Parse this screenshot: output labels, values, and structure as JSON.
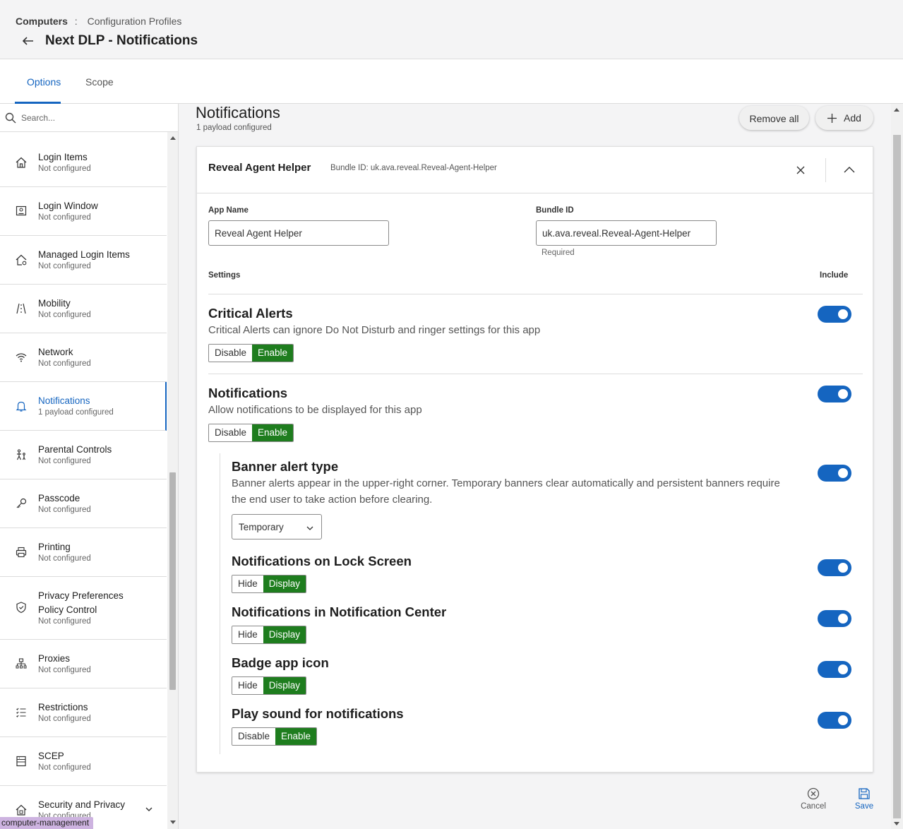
{
  "header": {
    "breadcrumb_root": "Computers",
    "breadcrumb_sep": ":",
    "breadcrumb_child": "Configuration Profiles",
    "title": "Next DLP - Notifications"
  },
  "tabs": [
    {
      "label": "Options",
      "active": true
    },
    {
      "label": "Scope",
      "active": false
    }
  ],
  "sidebar": {
    "search_placeholder": "Search...",
    "items": [
      {
        "label": "Login Items",
        "status": "Not configured",
        "icon": "home-icon"
      },
      {
        "label": "Login Window",
        "status": "Not configured",
        "icon": "login-window-icon"
      },
      {
        "label": "Managed Login Items",
        "status": "Not configured",
        "icon": "managed-home-icon"
      },
      {
        "label": "Mobility",
        "status": "Not configured",
        "icon": "mobility-icon"
      },
      {
        "label": "Network",
        "status": "Not configured",
        "icon": "wifi-icon"
      },
      {
        "label": "Notifications",
        "status": "1 payload configured",
        "icon": "bell-icon",
        "active": true
      },
      {
        "label": "Parental Controls",
        "status": "Not configured",
        "icon": "parental-icon"
      },
      {
        "label": "Passcode",
        "status": "Not configured",
        "icon": "key-icon"
      },
      {
        "label": "Printing",
        "status": "Not configured",
        "icon": "printer-icon"
      },
      {
        "label": "Privacy Preferences Policy Control",
        "status": "Not configured",
        "icon": "shield-icon"
      },
      {
        "label": "Proxies",
        "status": "Not configured",
        "icon": "proxies-icon"
      },
      {
        "label": "Restrictions",
        "status": "Not configured",
        "icon": "restrictions-icon"
      },
      {
        "label": "SCEP",
        "status": "Not configured",
        "icon": "scep-icon"
      },
      {
        "label": "Security and Privacy",
        "status": "Not configured",
        "icon": "security-icon"
      }
    ]
  },
  "status_tooltip": "computer-management",
  "main": {
    "title": "Notifications",
    "subtitle": "1 payload configured",
    "remove_all_label": "Remove all",
    "add_label": "Add",
    "card": {
      "app_title": "Reveal Agent Helper",
      "bundle_meta": "Bundle ID: uk.ava.reveal.Reveal-Agent-Helper",
      "app_name_label": "App Name",
      "app_name_value": "Reveal Agent Helper",
      "bundle_id_label": "Bundle ID",
      "bundle_id_value": "uk.ava.reveal.Reveal-Agent-Helper",
      "required_label": "Required",
      "settings_col": "Settings",
      "include_col": "Include",
      "critical": {
        "title": "Critical Alerts",
        "desc": "Critical Alerts can ignore Do Not Disturb and ringer settings for this app",
        "off": "Disable",
        "on": "Enable"
      },
      "notifications": {
        "title": "Notifications",
        "desc": "Allow notifications to be displayed for this app",
        "off": "Disable",
        "on": "Enable"
      },
      "banner": {
        "title": "Banner alert type",
        "desc": "Banner alerts appear in the upper-right corner. Temporary banners clear automatically and persistent banners require the end user to take action before clearing.",
        "select_value": "Temporary"
      },
      "lock_screen": {
        "title": "Notifications on Lock Screen",
        "off": "Hide",
        "on": "Display"
      },
      "notif_center": {
        "title": "Notifications in Notification Center",
        "off": "Hide",
        "on": "Display"
      },
      "badge": {
        "title": "Badge app icon",
        "off": "Hide",
        "on": "Display"
      },
      "sound": {
        "title": "Play sound for notifications",
        "off": "Disable",
        "on": "Enable"
      }
    },
    "cancel_label": "Cancel",
    "save_label": "Save"
  },
  "colors": {
    "accent": "#1565c0",
    "enabled_segment": "#1e7d1e"
  }
}
